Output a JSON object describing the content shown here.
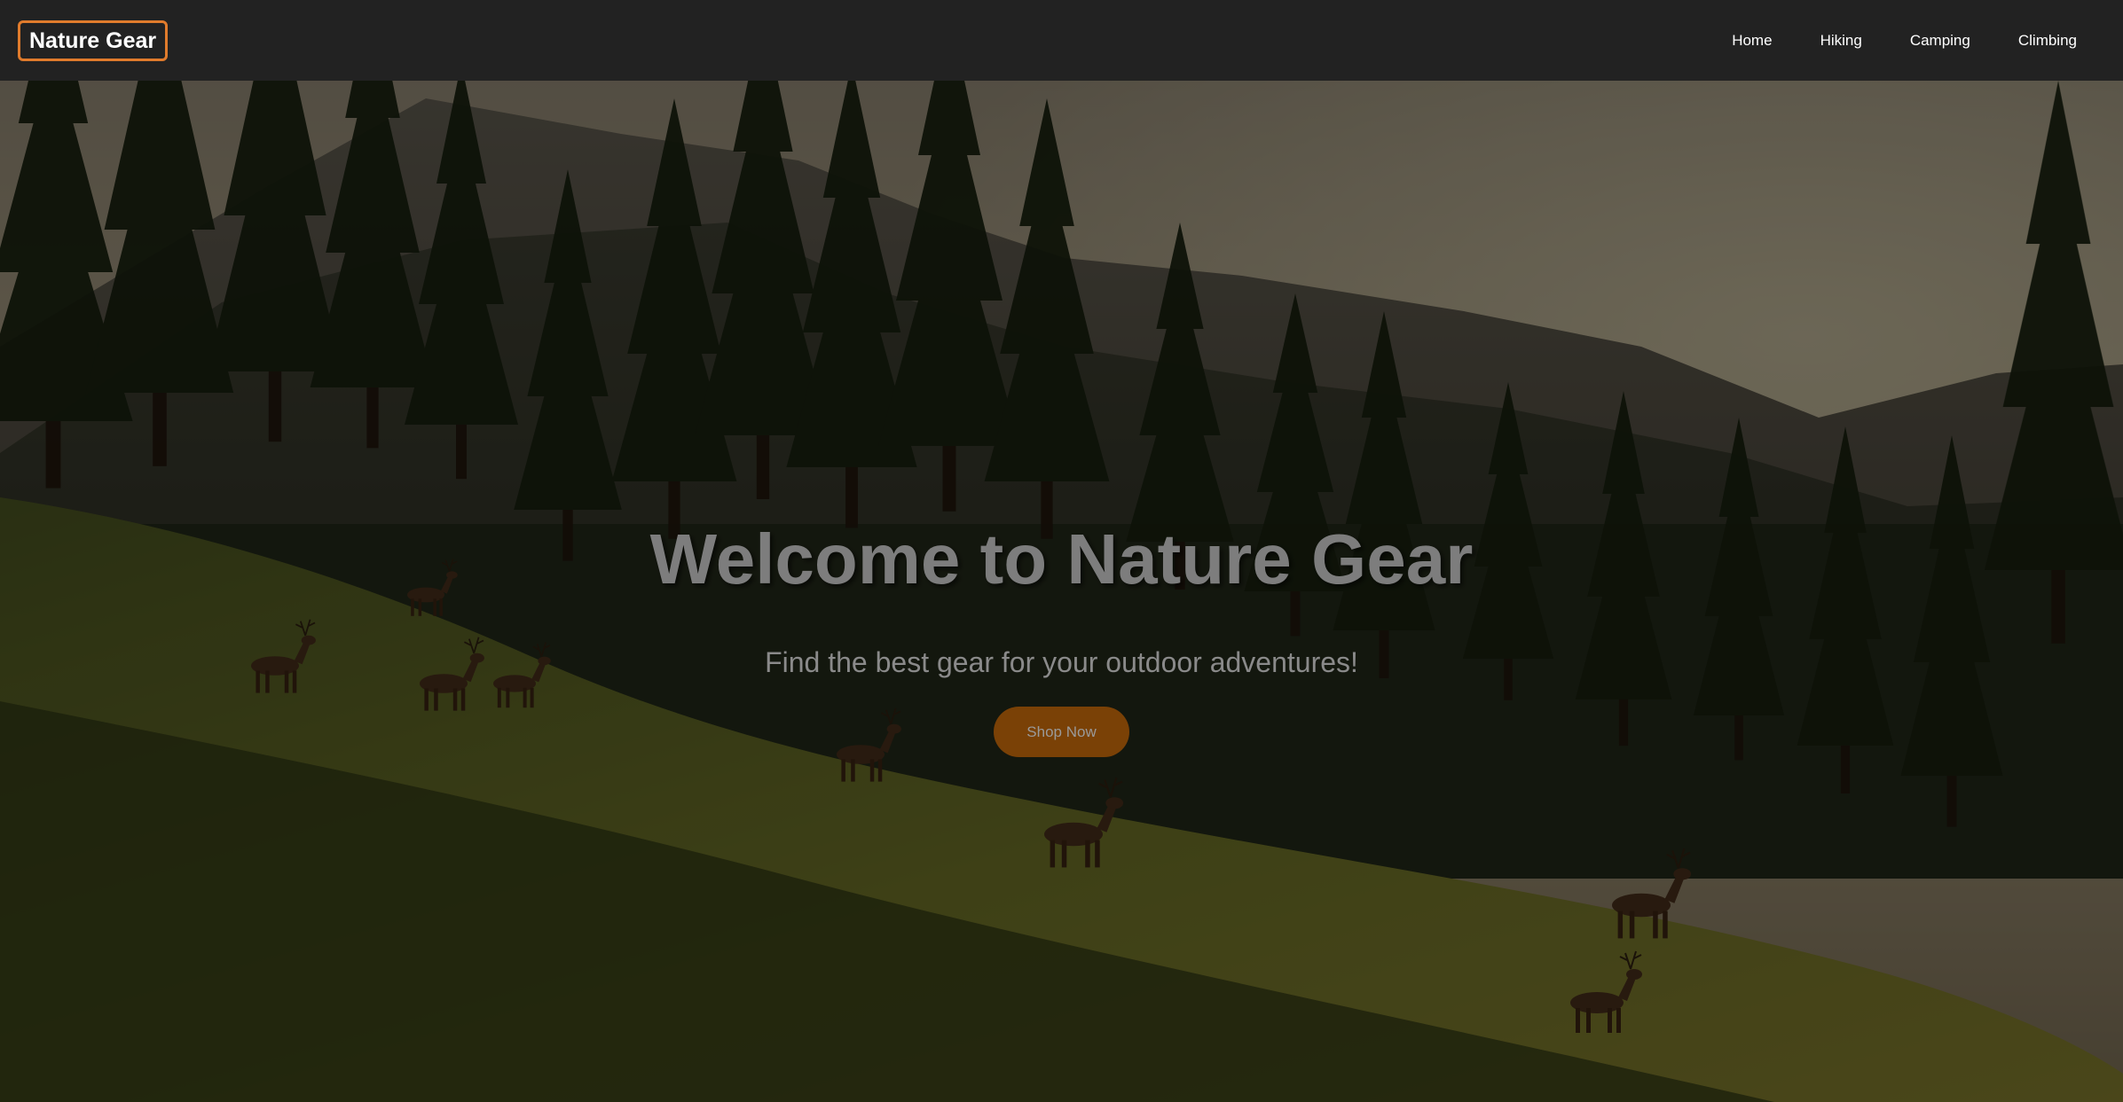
{
  "nav": {
    "logo": "Nature Gear",
    "links": [
      "Home",
      "Hiking",
      "Camping",
      "Climbing"
    ]
  },
  "hero": {
    "title": "Welcome to Nature Gear",
    "subtitle": "Find the best gear for your outdoor adventures!",
    "button_label": "Shop Now",
    "background": "forest-valley-with-deer-image"
  },
  "colors": {
    "navbar_bg": "#222222",
    "logo_border": "#e07b2c",
    "button_bg": "#7a4106"
  }
}
